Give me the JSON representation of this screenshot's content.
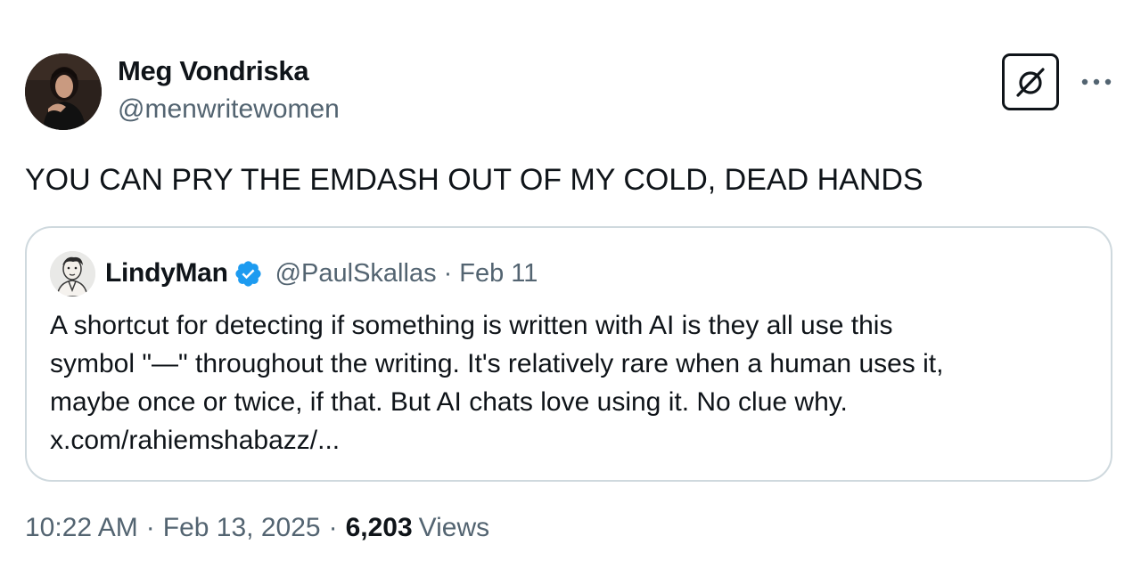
{
  "author": {
    "name": "Meg Vondriska",
    "handle": "@menwritewomen"
  },
  "header_actions": {
    "grok_icon": "grok-slashed-circle-icon",
    "more_icon": "more-horizontal-icon"
  },
  "tweet": {
    "text": "YOU CAN PRY THE EMDASH OUT OF MY COLD, DEAD HANDS"
  },
  "quote": {
    "name": "LindyMan",
    "verified_icon": "verified-badge-icon",
    "handle": "@PaulSkallas",
    "separator": "·",
    "date": "Feb 11",
    "lines": [
      "A shortcut for detecting if something is written with AI is they all use this",
      "symbol \"—\" throughout the writing. It's relatively rare when a human uses it,",
      "maybe once or twice, if that. But AI chats love using it. No clue why.",
      "x.com/rahiemshabazz/..."
    ]
  },
  "meta": {
    "time": "10:22 AM",
    "separator": "·",
    "date": "Feb 13, 2025",
    "views_count": "6,203",
    "views_label": "Views"
  },
  "colors": {
    "text": "#0f1419",
    "secondary": "#536471",
    "border": "#cfd9de",
    "verified": "#1d9bf0"
  }
}
